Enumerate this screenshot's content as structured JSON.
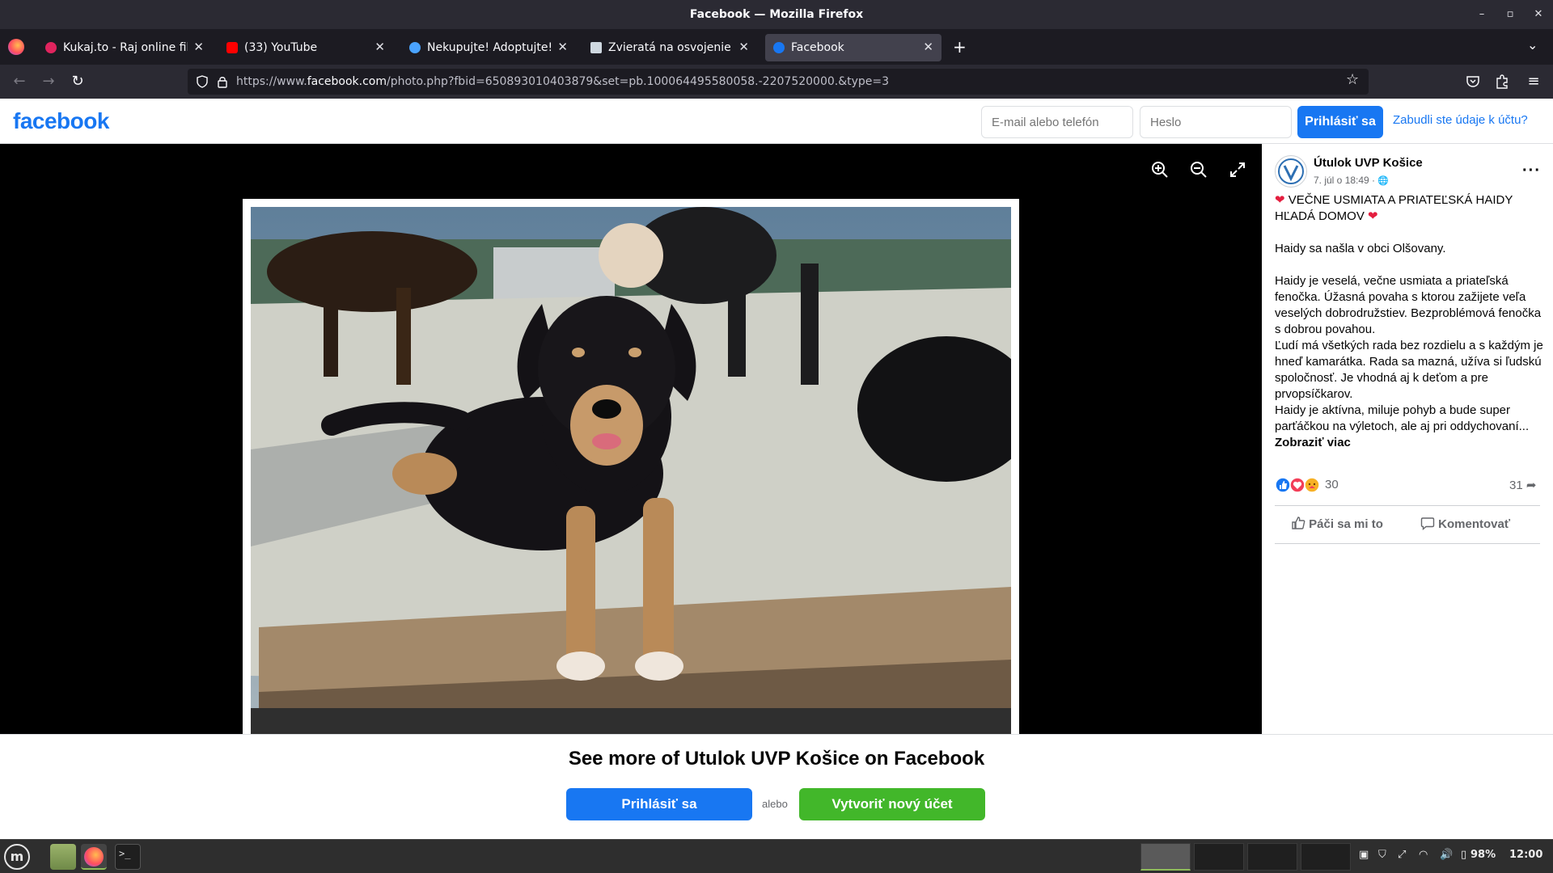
{
  "window": {
    "title": "Facebook — Mozilla Firefox"
  },
  "tabs": [
    {
      "label": "Kukaj.to - Raj online filmov a seriálov",
      "icon": "kukaj-favicon"
    },
    {
      "label": "(33) YouTube",
      "icon": "youtube-favicon"
    },
    {
      "label": "Nekupujte! Adoptujte! – Psí útulok",
      "icon": "nekupujte-favicon"
    },
    {
      "label": "Zvieratá na osvojenie",
      "icon": "zvierata-favicon"
    },
    {
      "label": "Facebook",
      "icon": "facebook-favicon"
    }
  ],
  "navbar": {
    "url_prefix": "https://www.",
    "url_domain": "facebook.com",
    "url_rest": "/photo.php?fbid=650893010403879&set=pb.100064495580058.-2207520000.&type=3"
  },
  "fb_header": {
    "logo": "facebook",
    "email_placeholder": "E-mail alebo telefón",
    "password_placeholder": "Heslo",
    "login_label": "Prihlásiť sa",
    "forgot_label": "Zabudli ste údaje k účtu?"
  },
  "post": {
    "page_name": "Útulok UVP Košice",
    "date": "7. júl o 18:49 ·",
    "headline": "VEČNE USMIATA A PRIATEĽSKÁ HAIDY HĽADÁ DOMOV",
    "para1": "Haidy sa našla v obci Olšovany.",
    "para2": "Haidy je veselá, večne usmiata a priateľská fenočka. Úžasná povaha s ktorou zažijete veľa veselých dobrodružstiev. Bezproblémová fenočka s dobrou povahou.",
    "para3": "Ľudí má všetkých rada bez rozdielu a s každým je hneď kamarátka. Rada sa mazná, užíva si ľudskú spoločnosť. Je vhodná aj k deťom a pre prvopsíčkarov.",
    "para4": "Haidy je aktívna, miluje pohyb a bude super parťáčkou na výletoch, ale aj pri oddychovaní...",
    "show_more": "Zobraziť viac",
    "reactions_count": "30",
    "shares_count": "31",
    "like_label": "Páči sa mi to",
    "comment_label": "Komentovať"
  },
  "banner": {
    "title": "See more of Utulok UVP Košice on Facebook",
    "login_label": "Prihlásiť sa",
    "or_label": "alebo",
    "create_label": "Vytvoriť nový účet"
  },
  "taskbar": {
    "battery": "98%",
    "clock": "12:00"
  },
  "colors": {
    "fb_blue": "#1877f2",
    "fb_green": "#42b72a",
    "heart_red": "#e41e3f"
  }
}
